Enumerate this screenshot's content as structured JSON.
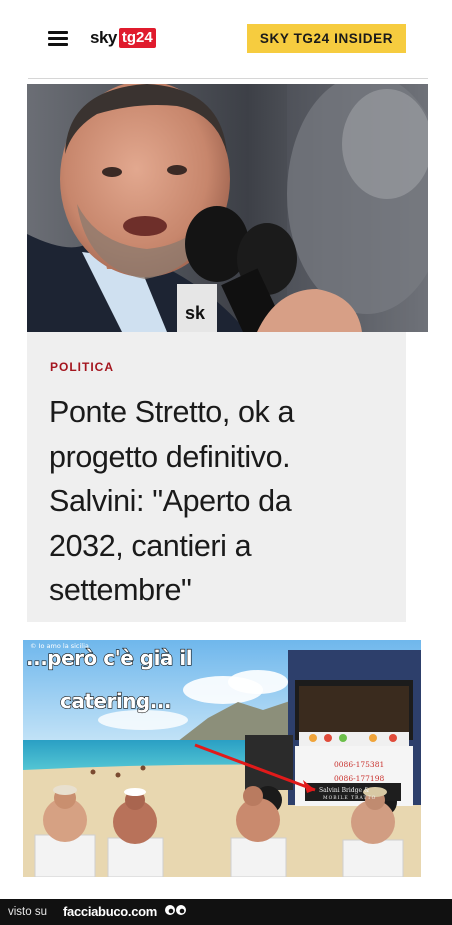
{
  "header": {
    "logo_sky": "sky",
    "logo_tg": "tg24",
    "insider_label": "SKY TG24 INSIDER",
    "brand_color": "#e01b2d",
    "button_color": "#f6cc3f"
  },
  "hero": {
    "image_icon": "photo-politician-speaking-at-microphones",
    "mic_label": "sk"
  },
  "article": {
    "category": "POLITICA",
    "category_color": "#a4161f",
    "headline_lines": [
      "Ponte Stretto, ok a",
      "progetto definitivo.",
      "Salvini: \"Aperto da",
      "2032, cantieri a",
      "settembre\""
    ]
  },
  "meme": {
    "credit": "© Io amo la sicilia",
    "caption_line1": "...però c'è già il",
    "caption_line2": "catering...",
    "truck_number_1": "0086-175381",
    "truck_number_2": "0086-177198",
    "truck_brand": "Salvini Bridge &",
    "truck_tagline": "MOBILE TRATTO"
  },
  "footer": {
    "prefix": "visto su",
    "brand": "facciabuco.com",
    "eyes_icon": "googly-eyes-icon"
  }
}
